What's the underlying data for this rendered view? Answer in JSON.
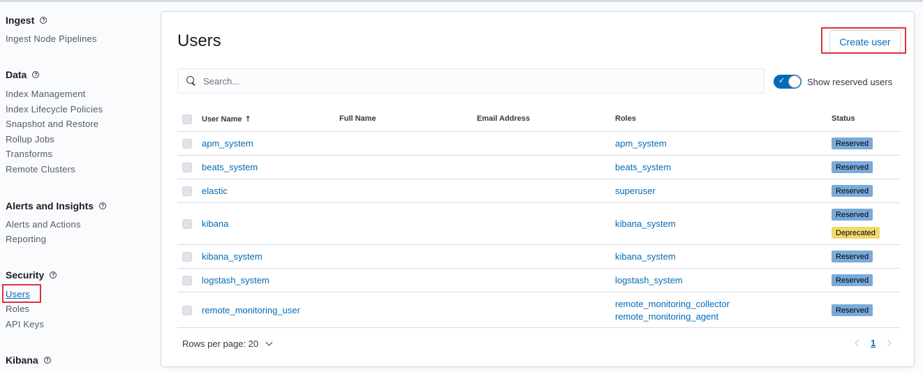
{
  "sidebar": {
    "sections": [
      {
        "title": "Ingest",
        "items": [
          "Ingest Node Pipelines"
        ]
      },
      {
        "title": "Data",
        "items": [
          "Index Management",
          "Index Lifecycle Policies",
          "Snapshot and Restore",
          "Rollup Jobs",
          "Transforms",
          "Remote Clusters"
        ]
      },
      {
        "title": "Alerts and Insights",
        "items": [
          "Alerts and Actions",
          "Reporting"
        ]
      },
      {
        "title": "Security",
        "items": [
          "Users",
          "Roles",
          "API Keys"
        ]
      },
      {
        "title": "Kibana",
        "items": []
      }
    ],
    "active_item": "Users"
  },
  "main": {
    "title": "Users",
    "create_button": "Create user",
    "search_placeholder": "Search...",
    "toggle_label": "Show reserved users",
    "toggle_on": true,
    "columns": [
      "User Name",
      "Full Name",
      "Email Address",
      "Roles",
      "Status"
    ],
    "rows": [
      {
        "user": "apm_system",
        "roles": [
          "apm_system"
        ],
        "status": [
          "Reserved"
        ]
      },
      {
        "user": "beats_system",
        "roles": [
          "beats_system"
        ],
        "status": [
          "Reserved"
        ]
      },
      {
        "user": "elastic",
        "roles": [
          "superuser"
        ],
        "status": [
          "Reserved"
        ]
      },
      {
        "user": "kibana",
        "roles": [
          "kibana_system"
        ],
        "status": [
          "Reserved",
          "Deprecated"
        ]
      },
      {
        "user": "kibana_system",
        "roles": [
          "kibana_system"
        ],
        "status": [
          "Reserved"
        ]
      },
      {
        "user": "logstash_system",
        "roles": [
          "logstash_system"
        ],
        "status": [
          "Reserved"
        ]
      },
      {
        "user": "remote_monitoring_user",
        "roles": [
          "remote_monitoring_collector",
          "remote_monitoring_agent"
        ],
        "status": [
          "Reserved"
        ]
      }
    ],
    "rows_per_page": "Rows per page: 20",
    "current_page": "1"
  },
  "colors": {
    "accent": "#006bb8",
    "reserved": "#79aad9",
    "deprecated": "#f1d86f",
    "highlight": "#e0303a"
  }
}
